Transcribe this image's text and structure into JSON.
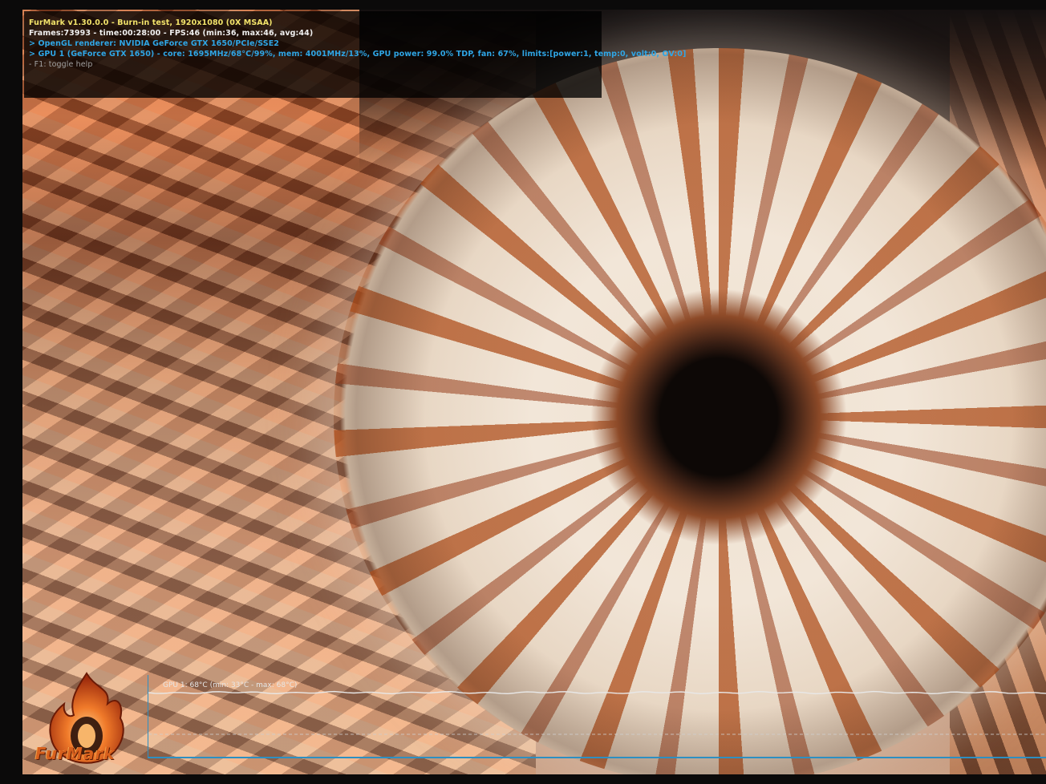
{
  "osd": {
    "title_line": "FurMark v1.30.0.0 - Burn-in test, 1920x1080 (0X MSAA)",
    "stats_line": "Frames:73993 - time:00:28:00 - FPS:46 (min:36, max:46, avg:44)",
    "renderer_line": "> OpenGL renderer: NVIDIA GeForce GTX 1650/PCIe/SSE2",
    "gpu_line": "> GPU 1 (GeForce GTX 1650) - core: 1695MHz/68°C/99%, mem: 4001MHz/13%, GPU power: 99.0% TDP, fan: 67%, limits:[power:1, temp:0, volt:0, OV:0]",
    "help_line": "- F1: toggle help"
  },
  "logo": {
    "text": "FurMark",
    "icon": "flame-icon"
  },
  "graph": {
    "label": "GPU 1: 68°C (min: 33°C - max: 68°C)",
    "line_color": "#e8e8e8",
    "axis_color": "#2d8fc2"
  },
  "colors": {
    "osd_title": "#f2e36a",
    "osd_gpu": "#2fa6e6",
    "logo_orange": "#d8601d"
  }
}
